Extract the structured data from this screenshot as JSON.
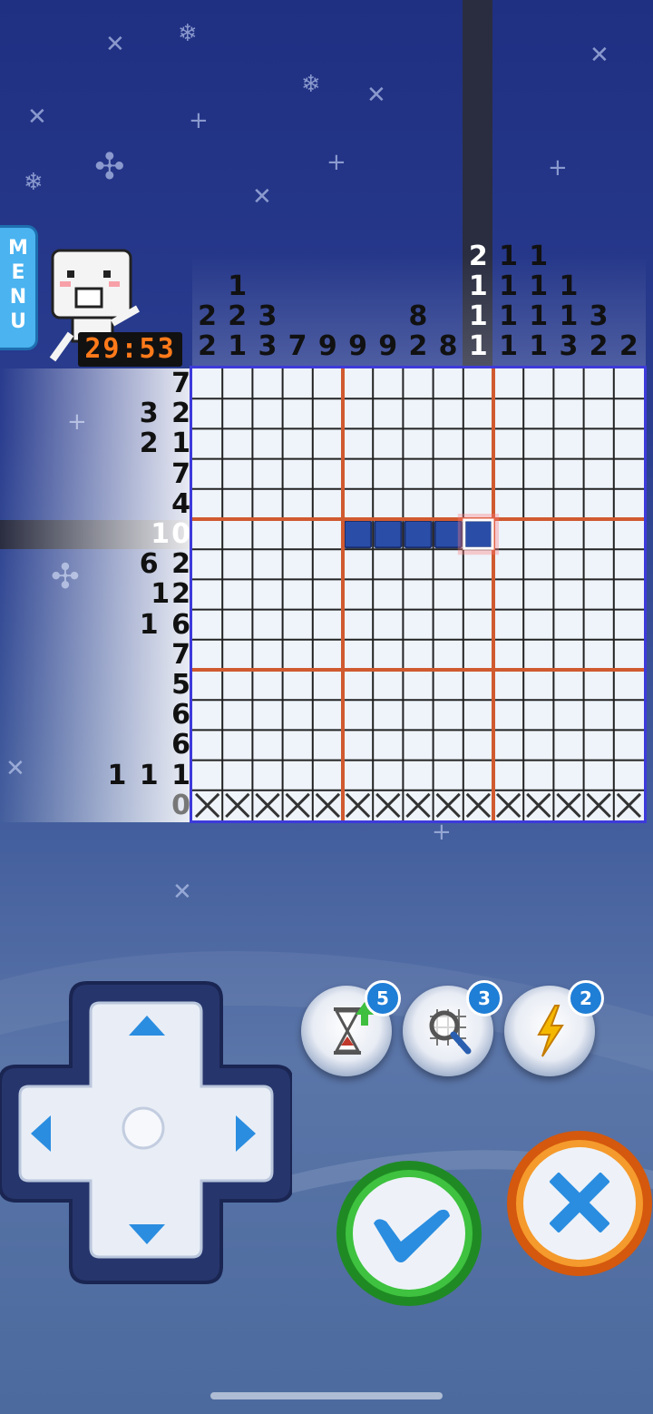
{
  "menu": {
    "letters": "MENU"
  },
  "timer": {
    "value": "29:53"
  },
  "puzzle": {
    "size": 15,
    "column_clues": [
      [
        "2",
        "2"
      ],
      [
        "1",
        "2",
        "1"
      ],
      [
        "3",
        "3"
      ],
      [
        "7"
      ],
      [
        "9"
      ],
      [
        "9"
      ],
      [
        "9"
      ],
      [
        "8",
        "2"
      ],
      [
        "8"
      ],
      [
        "2",
        "1",
        "1",
        "1"
      ],
      [
        "1",
        "1",
        "1",
        "1"
      ],
      [
        "1",
        "1",
        "1",
        "1"
      ],
      [
        "1",
        "1",
        "3"
      ],
      [
        "3",
        "2"
      ],
      [
        "2"
      ]
    ],
    "row_clues": [
      "7",
      "3 2",
      "2 1",
      "7",
      "4",
      "10",
      "6 2",
      "12",
      "1 6",
      "7",
      "5",
      "6",
      "6",
      "1 1 1",
      "0"
    ],
    "highlighted_column": 9,
    "highlighted_row": 5,
    "filled_cells": [
      [
        5,
        5
      ],
      [
        5,
        6
      ],
      [
        5,
        7
      ],
      [
        5,
        8
      ],
      [
        5,
        9
      ]
    ],
    "crossed_rows": [
      14
    ],
    "cursor": [
      5,
      9
    ]
  },
  "powerups": [
    {
      "name": "time",
      "icon": "hourglass-icon",
      "count": "5"
    },
    {
      "name": "reveal",
      "icon": "magnifier-icon",
      "count": "3"
    },
    {
      "name": "lightning",
      "icon": "lightning-icon",
      "count": "2"
    }
  ],
  "colors": {
    "grid_border": "#3d3adb",
    "section_line": "#d05a30",
    "filled": "#2a4ea8",
    "cursor": "#ff6a6a"
  }
}
